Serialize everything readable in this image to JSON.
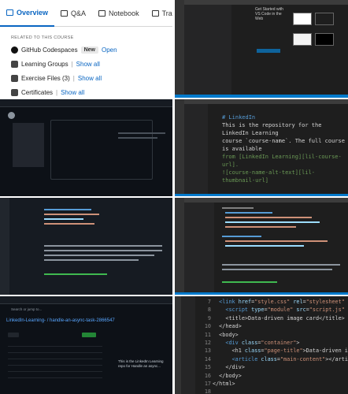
{
  "tile1": {
    "tabs": [
      {
        "label": "Overview",
        "active": true
      },
      {
        "label": "Q&A",
        "active": false
      },
      {
        "label": "Notebook",
        "active": false
      },
      {
        "label": "Transc",
        "active": false
      }
    ],
    "section_label": "RELATED TO THIS COURSE",
    "rows": [
      {
        "name": "GitHub Codespaces",
        "badge": "New",
        "action": "Open"
      },
      {
        "name": "Learning Groups",
        "action": "Show all"
      },
      {
        "name": "Exercise Files (3)",
        "action": "Show all"
      },
      {
        "name": "Certificates",
        "action": "Show all"
      }
    ]
  },
  "tile2": {
    "welcome_title": "Get Started with VS Code in the Web",
    "accent": "#0e639c"
  },
  "tile4": {
    "lines": [
      "# LinkedIn",
      "This is the repository for the LinkedIn Learning",
      "course `course-name`. The full course is available",
      "from [LinkedIn Learning][lil-course-url].",
      "",
      "![course-name-alt-text][lil-thumbnail-url]"
    ]
  },
  "tile7": {
    "search": "Search or jump to...",
    "org": "LinkedIn-Learning- / handle-an-async-task-2866547",
    "about": "This is the LinkedIn Learning repo for Handle an async...",
    "code_button": "Code"
  },
  "tile8": {
    "line_numbers": [
      "7",
      "8",
      "9",
      "10",
      "11",
      "12",
      "13",
      "14",
      "15",
      "16",
      "17",
      "18"
    ],
    "accent": "#007acc"
  }
}
